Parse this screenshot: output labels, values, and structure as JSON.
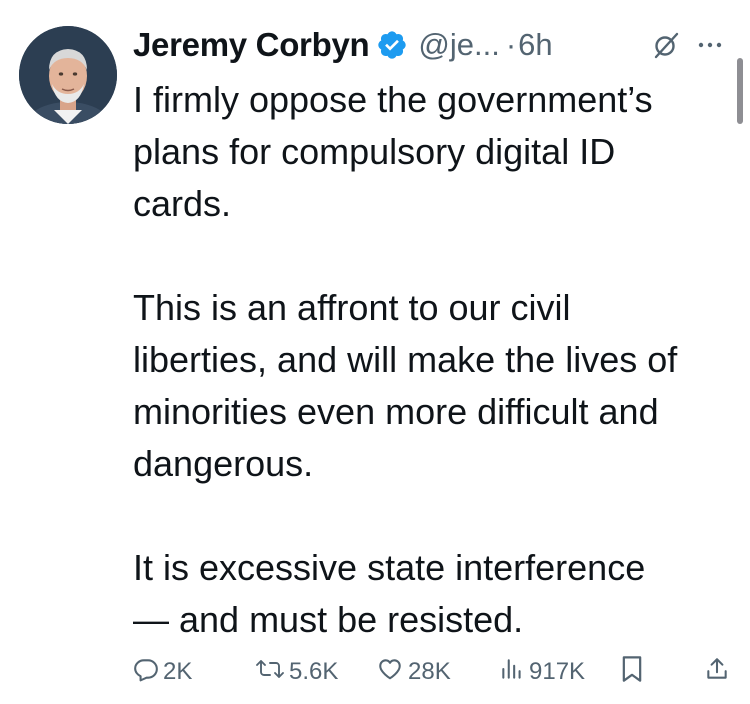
{
  "tweet": {
    "author_name": "Jeremy Corbyn",
    "handle": "@je...",
    "separator": "·",
    "time": "6h",
    "paragraphs": [
      [
        "I firmly oppose the government’s",
        "plans for compulsory digital ID",
        "cards."
      ],
      [
        "This is an affront to our civil",
        "liberties, and will make the lives of",
        "minorities even more difficult and",
        "dangerous."
      ],
      [
        "It is excessive state interference",
        "— and must be resisted."
      ]
    ]
  },
  "actions": {
    "replies": "2K",
    "reposts": "5.6K",
    "likes": "28K",
    "views": "917K"
  },
  "icons": {
    "verified": "verified-badge-icon",
    "grok": "grok-icon",
    "more": "more-dots-icon",
    "reply": "reply-icon",
    "repost": "repost-icon",
    "like": "heart-icon",
    "views": "views-icon",
    "bookmark": "bookmark-icon",
    "share": "share-icon"
  },
  "colors": {
    "text": "#0f1419",
    "secondary": "#536471",
    "verified": "#1d9bf0",
    "background": "#ffffff"
  }
}
